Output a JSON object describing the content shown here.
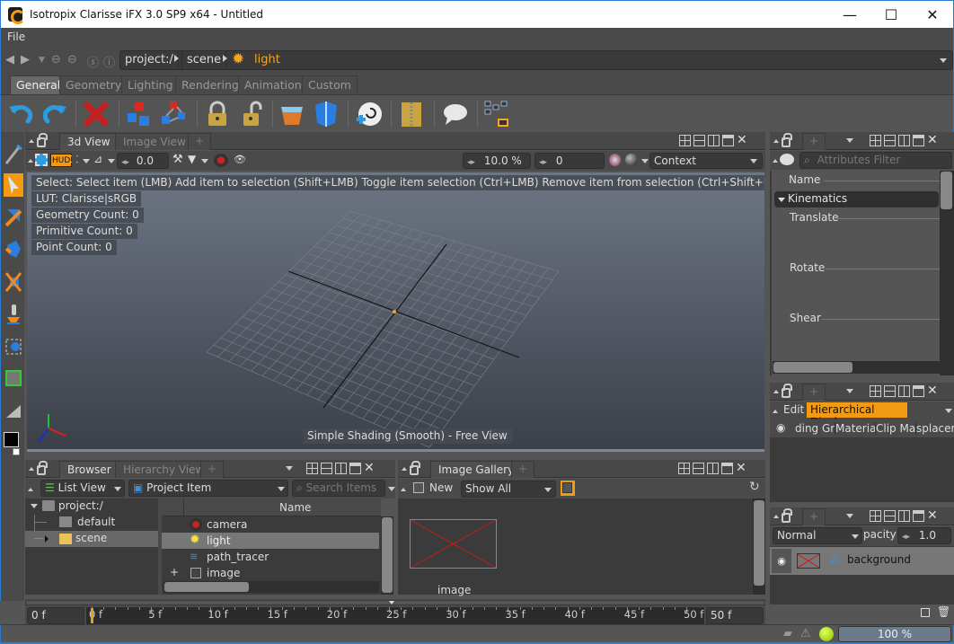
{
  "window": {
    "title": "Isotropix Clarisse iFX 3.0 SP9 x64  - Untitled",
    "controls": {
      "minimize": "—",
      "maximize": "☐",
      "close": "✕"
    }
  },
  "menu": {
    "items": [
      "File"
    ]
  },
  "navigation": {
    "breadcrumb": [
      "project:/",
      "scene",
      "light"
    ],
    "active_item_color": "#f5a623"
  },
  "shelf": {
    "tabs": [
      "General",
      "Geometry",
      "Lighting",
      "Rendering",
      "Animation",
      "Custom"
    ],
    "active_tab": "General",
    "tools": [
      "undo-icon",
      "redo-icon",
      "delete-icon",
      "instance-icon",
      "group-icon",
      "lock-icon",
      "unlock-icon",
      "new-context-icon",
      "new-box-icon",
      "import-icon",
      "archive-icon",
      "comment-icon",
      "node-graph-icon"
    ]
  },
  "left_toolbar": {
    "tools": [
      "link-tool",
      "select-tool",
      "translate-tool",
      "rotate-tool",
      "scale-tool",
      "stamp-tool",
      "camera-tool",
      "texture-tool",
      "ruler-tool"
    ],
    "active_tool": "select-tool"
  },
  "view3d": {
    "tabs": [
      "3d View",
      "Image View",
      "+"
    ],
    "active_tab": "3d View",
    "toolbar": {
      "hud_label": "HUD",
      "value1": "0.0",
      "zoom_percent": "10.0 %",
      "value2": "0",
      "context_label": "Context"
    },
    "hud": {
      "select_hint": "Select: Select item (LMB)  Add item to selection (Shift+LMB)  Toggle item selection (Ctrl+LMB)  Remove item from selection (Ctrl+Shift+LMB)  - Mode: Au",
      "lut": "LUT: Clarisse|sRGB",
      "geometry_count": "Geometry Count: 0",
      "primitive_count": "Primitive Count: 0",
      "point_count": "Point Count: 0"
    },
    "status": "Simple Shading (Smooth) - Free View"
  },
  "attribute_editor": {
    "filter_placeholder": "Attributes Filter",
    "name_label": "Name",
    "group": "Kinematics",
    "attributes": [
      "Translate",
      "Rotate",
      "Shear"
    ]
  },
  "material_panel": {
    "edit_label": "Edit",
    "mode_label": "Hierarchical Display",
    "columns": [
      "ding Grc",
      "Material",
      "Clip Map",
      "splacem"
    ]
  },
  "layers_panel": {
    "blend_mode": "Normal",
    "opacity_label": "pacity",
    "opacity_value": "1.0",
    "layers": [
      {
        "name": "background"
      }
    ]
  },
  "browser": {
    "tabs": [
      "Browser",
      "Hierarchy View",
      "+"
    ],
    "active_tab": "Browser",
    "view_mode": "List View",
    "filter": "Project Item",
    "search_placeholder": "Search Items",
    "tree": [
      {
        "label": "project:/",
        "expanded": true
      },
      {
        "label": "default",
        "locked": true
      },
      {
        "label": "scene",
        "selected": true
      }
    ],
    "list_header": "Name",
    "items": [
      {
        "label": "camera",
        "icon": "camera-icon"
      },
      {
        "label": "light",
        "icon": "light-icon",
        "selected": true
      },
      {
        "label": "path_tracer",
        "icon": "renderer-icon"
      },
      {
        "label": "image",
        "icon": "image-icon",
        "expandable": "+"
      }
    ]
  },
  "image_gallery": {
    "tabs": [
      "Image Gallery",
      "+"
    ],
    "new_label": "New",
    "show_filter": "Show All",
    "images": [
      {
        "label": "image"
      }
    ]
  },
  "timeline": {
    "start": "0 f",
    "end": "50 f",
    "current_frame": 0,
    "ticks": [
      "0 f",
      "5 f",
      "10 f",
      "15 f",
      "20 f",
      "25 f",
      "30 f",
      "35 f",
      "40 f",
      "45 f",
      "50 f"
    ]
  },
  "statusbar": {
    "progress": "100 %"
  }
}
